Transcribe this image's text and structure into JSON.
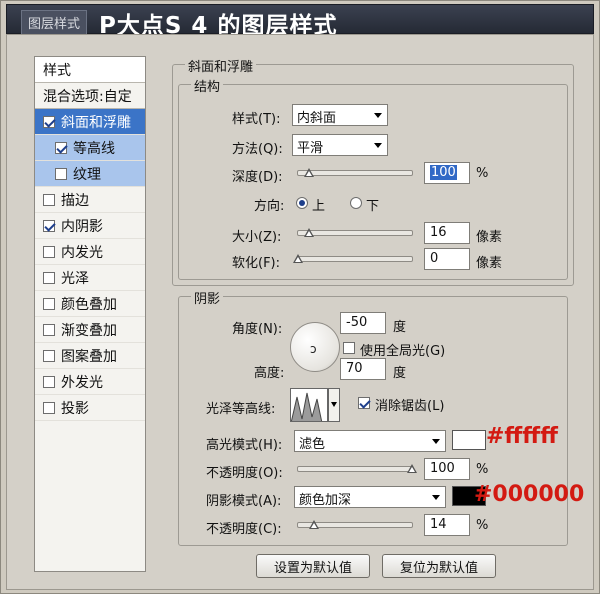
{
  "window": {
    "tab_label": "图层样式",
    "title": "P大点S 4 的图层样式"
  },
  "sidebar": {
    "header": "样式",
    "blend_options": "混合选项:自定",
    "items": [
      {
        "label": "斜面和浮雕",
        "checked": true,
        "selected": true
      },
      {
        "label": "等高线",
        "checked": true,
        "sub": true
      },
      {
        "label": "纹理",
        "checked": false,
        "sub": true
      },
      {
        "label": "描边",
        "checked": false
      },
      {
        "label": "内阴影",
        "checked": true
      },
      {
        "label": "内发光",
        "checked": false
      },
      {
        "label": "光泽",
        "checked": false
      },
      {
        "label": "颜色叠加",
        "checked": false
      },
      {
        "label": "渐变叠加",
        "checked": false
      },
      {
        "label": "图案叠加",
        "checked": false
      },
      {
        "label": "外发光",
        "checked": false
      },
      {
        "label": "投影",
        "checked": false
      }
    ]
  },
  "bevel": {
    "section_title": "斜面和浮雕",
    "structure_title": "结构",
    "style_label": "样式(T):",
    "style_value": "内斜面",
    "technique_label": "方法(Q):",
    "technique_value": "平滑",
    "depth_label": "深度(D):",
    "depth_value": "100",
    "depth_fraction": 0.1,
    "percent": "%",
    "direction_label": "方向:",
    "dir_up": "上",
    "dir_down": "下",
    "size_label": "大小(Z):",
    "size_value": "16",
    "size_fraction": 0.1,
    "pixels": "像素",
    "soften_label": "软化(F):",
    "soften_value": "0",
    "soften_fraction": 0.0
  },
  "shading": {
    "title": "阴影",
    "angle_label": "角度(N):",
    "angle_value": "-50",
    "degree": "度",
    "global_light_label": "使用全局光(G)",
    "global_light_checked": false,
    "altitude_label": "高度:",
    "altitude_value": "70",
    "gloss_contour_label": "光泽等高线:",
    "anti_aliased_label": "消除锯齿(L)",
    "anti_aliased_checked": true,
    "highlight_mode_label": "高光模式(H):",
    "highlight_mode_value": "滤色",
    "highlight_color": "#ffffff",
    "highlight_opacity_label": "不透明度(O):",
    "highlight_opacity_value": "100",
    "highlight_opacity_fraction": 1.0,
    "shadow_mode_label": "阴影模式(A):",
    "shadow_mode_value": "颜色加深",
    "shadow_color": "#000000",
    "shadow_opacity_label": "不透明度(C):",
    "shadow_opacity_value": "14",
    "shadow_opacity_fraction": 0.14
  },
  "annotations": {
    "highlight_note": "#ffffff",
    "shadow_note": "#000000"
  },
  "buttons": {
    "make_default": "设置为默认值",
    "reset_default": "复位为默认值"
  }
}
